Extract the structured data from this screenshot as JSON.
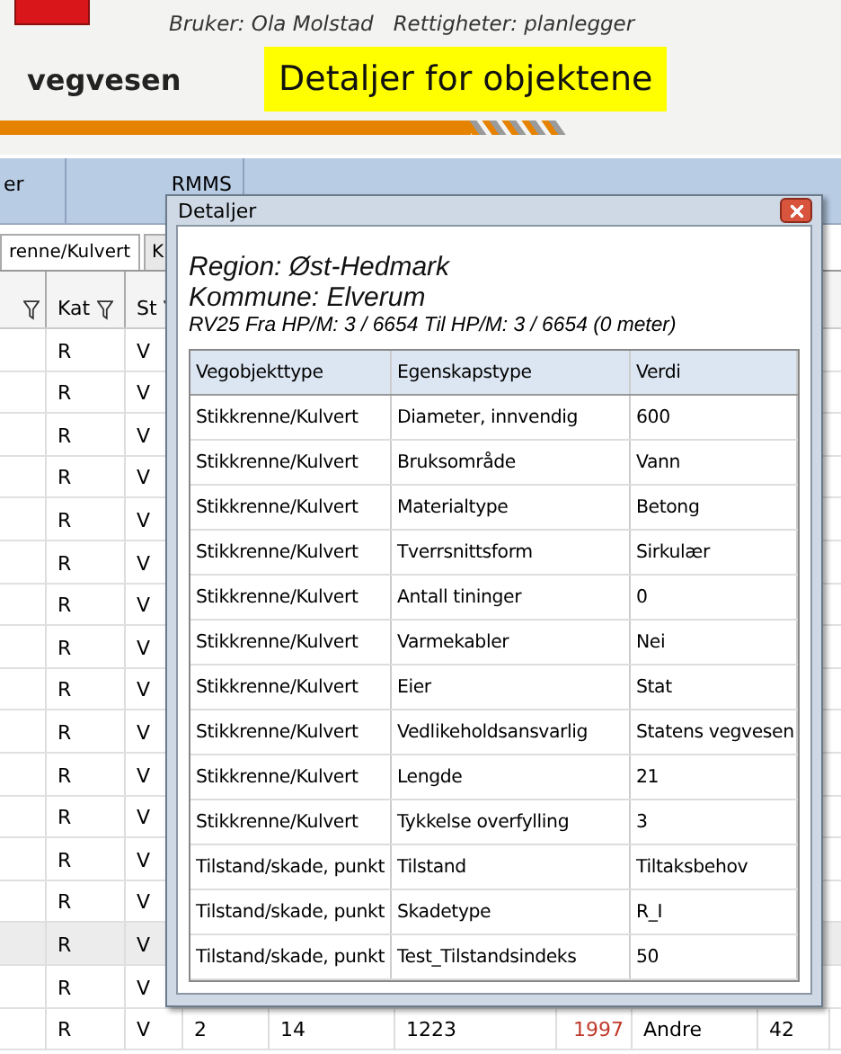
{
  "header": {
    "user_line": "Bruker: Ola Molstad   Rettigheter: planlegger",
    "brand": "vegvesen",
    "callout": "Detaljer for objektene"
  },
  "tabs": [
    {
      "label": "er",
      "selected": false
    },
    {
      "label": "RMMS",
      "selected": false
    }
  ],
  "subtabs": [
    {
      "label": "renne/Kulvert",
      "selected": true
    },
    {
      "label": "K",
      "selected": false
    }
  ],
  "grid": {
    "columns": [
      "Kat",
      "St"
    ],
    "rows": [
      {
        "kat": "R",
        "st": "V",
        "selected": false
      },
      {
        "kat": "R",
        "st": "V",
        "selected": false
      },
      {
        "kat": "R",
        "st": "V",
        "selected": false
      },
      {
        "kat": "R",
        "st": "V",
        "selected": false
      },
      {
        "kat": "R",
        "st": "V",
        "selected": false
      },
      {
        "kat": "R",
        "st": "V",
        "selected": false
      },
      {
        "kat": "R",
        "st": "V",
        "selected": false
      },
      {
        "kat": "R",
        "st": "V",
        "selected": false
      },
      {
        "kat": "R",
        "st": "V",
        "selected": false
      },
      {
        "kat": "R",
        "st": "V",
        "selected": false
      },
      {
        "kat": "R",
        "st": "V",
        "selected": false
      },
      {
        "kat": "R",
        "st": "V",
        "selected": false
      },
      {
        "kat": "R",
        "st": "V",
        "selected": false
      },
      {
        "kat": "R",
        "st": "V",
        "selected": false
      },
      {
        "kat": "R",
        "st": "V",
        "selected": true
      },
      {
        "kat": "R",
        "st": "V",
        "selected": false
      },
      {
        "kat": "R",
        "st": "V",
        "selected": false,
        "more": [
          {
            "text": "2",
            "alert": false
          },
          {
            "text": "14",
            "alert": false
          },
          {
            "text": "1223",
            "alert": false
          },
          {
            "text": "1997",
            "alert": true
          },
          {
            "text": "Andre",
            "alert": false
          },
          {
            "text": "42",
            "alert": false
          }
        ]
      }
    ]
  },
  "dialog": {
    "title": "Detaljer",
    "region": "Region: Øst-Hedmark",
    "kommune": "Kommune: Elverum",
    "location": "RV25 Fra HP/M: 3 / 6654 Til HP/M: 3 / 6654 (0 meter)",
    "columns": [
      "Vegobjekttype",
      "Egenskapstype",
      "Verdi"
    ],
    "rows": [
      [
        "Stikkrenne/Kulvert",
        "Diameter, innvendig",
        "600"
      ],
      [
        "Stikkrenne/Kulvert",
        "Bruksområde",
        "Vann"
      ],
      [
        "Stikkrenne/Kulvert",
        "Materialtype",
        "Betong"
      ],
      [
        "Stikkrenne/Kulvert",
        "Tverrsnittsform",
        "Sirkulær"
      ],
      [
        "Stikkrenne/Kulvert",
        "Antall tininger",
        "0"
      ],
      [
        "Stikkrenne/Kulvert",
        "Varmekabler",
        "Nei"
      ],
      [
        "Stikkrenne/Kulvert",
        "Eier",
        "Stat"
      ],
      [
        "Stikkrenne/Kulvert",
        "Vedlikeholdsansvarlig",
        "Statens vegvesen"
      ],
      [
        "Stikkrenne/Kulvert",
        "Lengde",
        "21"
      ],
      [
        "Stikkrenne/Kulvert",
        "Tykkelse overfylling",
        "3"
      ],
      [
        "Tilstand/skade, punkt",
        "Tilstand",
        "Tiltaksbehov"
      ],
      [
        "Tilstand/skade, punkt",
        "Skadetype",
        "R_I"
      ],
      [
        "Tilstand/skade, punkt",
        "Test_Tilstandsindeks",
        "50"
      ]
    ]
  }
}
